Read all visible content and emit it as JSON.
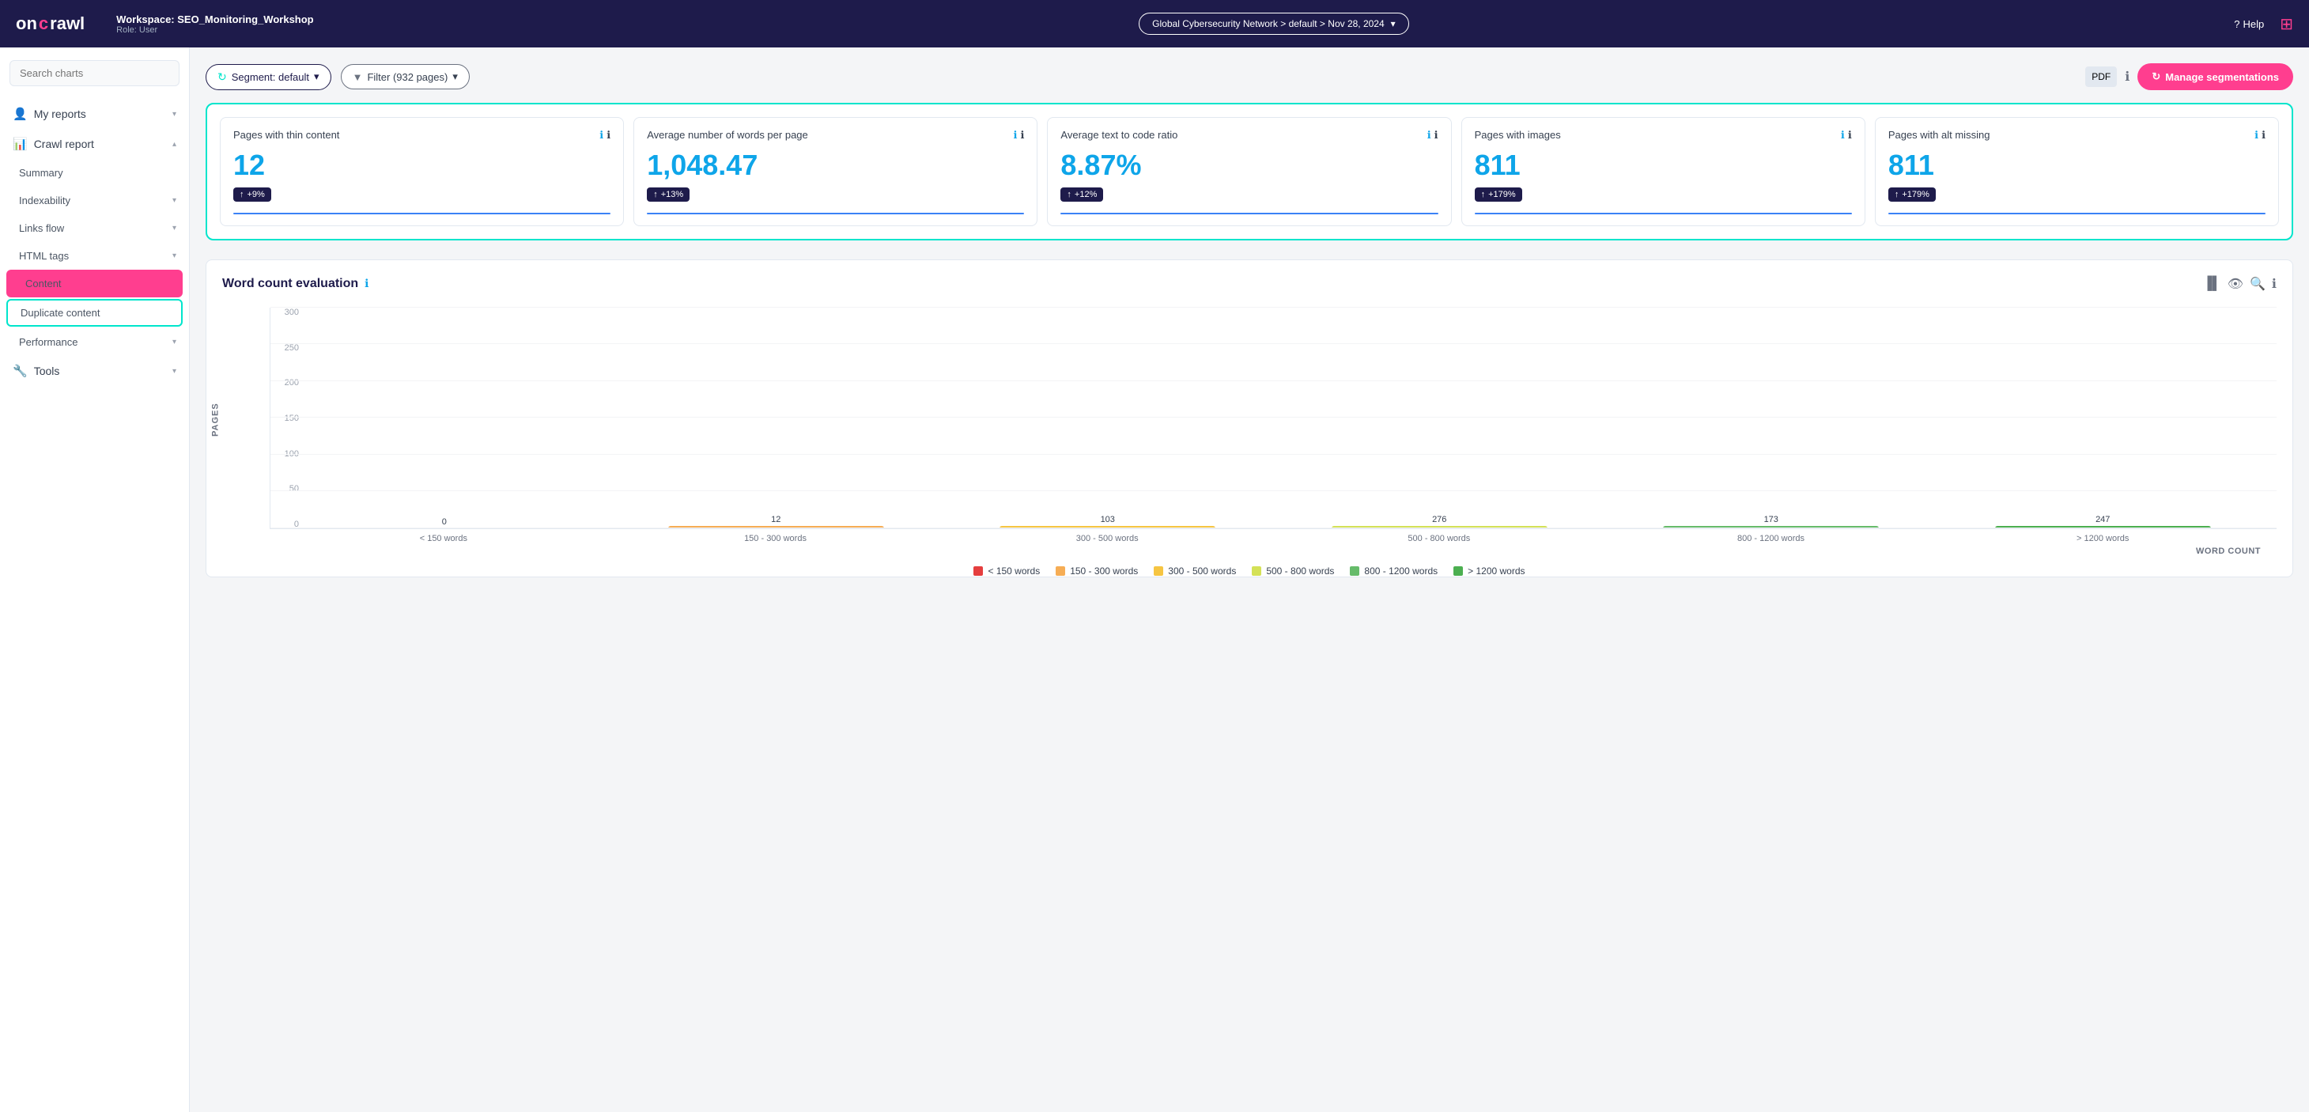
{
  "topnav": {
    "logo": "oncrawl",
    "workspace": "Workspace: SEO_Monitoring_Workshop",
    "role": "Role: User",
    "breadcrumb": "Global Cybersecurity Network  >  default  >  Nov 28, 2024",
    "help": "Help",
    "help_icon": "?"
  },
  "toolbar": {
    "segment_label": "Segment: default",
    "filter_label": "Filter (932 pages)",
    "pdf_label": "PDF",
    "manage_label": "Manage segmentations"
  },
  "sidebar": {
    "search_placeholder": "Search charts",
    "items": [
      {
        "id": "my-reports",
        "label": "My reports",
        "icon": "person",
        "has_arrow": true
      },
      {
        "id": "crawl-report",
        "label": "Crawl report",
        "icon": "chart",
        "has_arrow": true
      },
      {
        "id": "summary",
        "label": "Summary",
        "has_arrow": false,
        "indent": true
      },
      {
        "id": "indexability",
        "label": "Indexability",
        "has_arrow": true,
        "indent": true
      },
      {
        "id": "links-flow",
        "label": "Links flow",
        "has_arrow": true,
        "indent": true
      },
      {
        "id": "html-tags",
        "label": "HTML tags",
        "has_arrow": true,
        "indent": true
      },
      {
        "id": "content",
        "label": "Content",
        "active": true,
        "indent": true
      },
      {
        "id": "duplicate-content",
        "label": "Duplicate content",
        "indent": true,
        "highlighted": true
      },
      {
        "id": "performance",
        "label": "Performance",
        "has_arrow": true,
        "indent": true
      },
      {
        "id": "tools",
        "label": "Tools",
        "icon": "wrench",
        "has_arrow": true
      }
    ]
  },
  "metrics": [
    {
      "id": "thin-content",
      "title": "Pages with thin content",
      "value": "12",
      "change": "+9%",
      "change_up": true
    },
    {
      "id": "avg-words",
      "title": "Average number of words per page",
      "value": "1,048.47",
      "change": "+13%",
      "change_up": true
    },
    {
      "id": "text-code-ratio",
      "title": "Average text to code ratio",
      "value": "8.87%",
      "change": "+12%",
      "change_up": true
    },
    {
      "id": "pages-images",
      "title": "Pages with images",
      "value": "811",
      "change": "+179%",
      "change_up": true
    },
    {
      "id": "pages-alt-missing",
      "title": "Pages with alt missing",
      "value": "811",
      "change": "+179%",
      "change_up": true
    }
  ],
  "word_count_chart": {
    "title": "Word count evaluation",
    "x_axis_title": "WORD COUNT",
    "y_axis_title": "PAGES",
    "bars": [
      {
        "label": "< 150 words",
        "value": 0,
        "color": "#e53e3e",
        "legend_color": "#e53e3e"
      },
      {
        "label": "150 - 300 words",
        "value": 12,
        "color": "#f6ad55",
        "legend_color": "#f6ad55"
      },
      {
        "label": "300 - 500 words",
        "value": 103,
        "color": "#f6c542",
        "legend_color": "#f6c542"
      },
      {
        "label": "500 - 800 words",
        "value": 276,
        "color": "#d4e157",
        "legend_color": "#d4e157"
      },
      {
        "label": "800 - 1200 words",
        "value": 173,
        "color": "#66bb6a",
        "legend_color": "#66bb6a"
      },
      {
        "label": "> 1200 words",
        "value": 247,
        "color": "#4caf50",
        "legend_color": "#4caf50"
      }
    ],
    "y_max": 300,
    "y_ticks": [
      0,
      50,
      100,
      150,
      200,
      250,
      300
    ],
    "legend": [
      {
        "label": "< 150 words",
        "color": "#e53e3e"
      },
      {
        "label": "150 - 300 words",
        "color": "#f6ad55"
      },
      {
        "label": "300 - 500 words",
        "color": "#f6c542"
      },
      {
        "label": "500 - 800 words",
        "color": "#d4e157"
      },
      {
        "label": "800 - 1200 words",
        "color": "#66bb6a"
      },
      {
        "label": "> 1200 words",
        "color": "#4caf50"
      }
    ]
  }
}
